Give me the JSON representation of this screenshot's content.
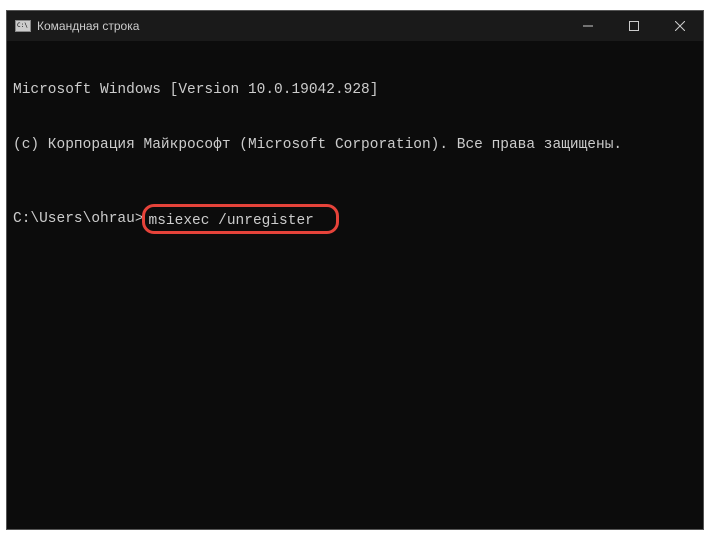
{
  "window": {
    "title": "Командная строка"
  },
  "terminal": {
    "line1": "Microsoft Windows [Version 10.0.19042.928]",
    "line2": "(c) Корпорация Майкрософт (Microsoft Corporation). Все права защищены.",
    "prompt": "C:\\Users\\ohrau>",
    "command": "msiexec /unregister"
  }
}
